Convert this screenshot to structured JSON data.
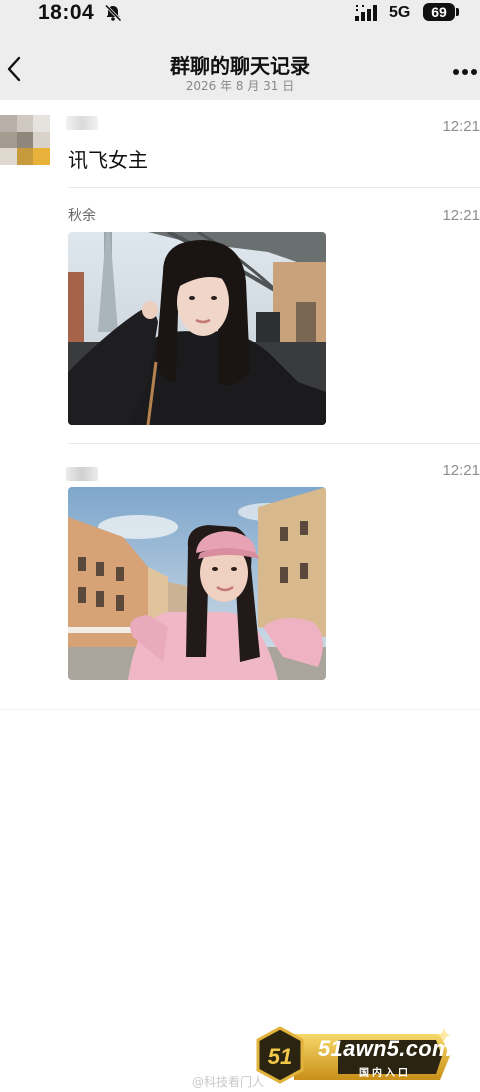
{
  "status_bar": {
    "time": "18:04",
    "network": "5G",
    "battery": "69",
    "icons": [
      "mute-icon",
      "signal-icon"
    ]
  },
  "header": {
    "back_icon": "chevron-left-icon",
    "title": "群聊的聊天记录",
    "subtitle": "2026 年 8 月 31 日",
    "more_icon": "more-dots-icon"
  },
  "messages": [
    {
      "sender": "",
      "time": "12:21",
      "text": "讯飞女主"
    },
    {
      "sender": "秋余",
      "time": "12:21",
      "type": "image",
      "image": "selfie-black-sweater"
    },
    {
      "sender": "",
      "time": "12:21",
      "type": "image",
      "image": "selfie-pink-cap"
    }
  ],
  "watermark": {
    "logo_text": "51",
    "site": "51awn5.com",
    "tag": "国内入口",
    "weibo_handle": "@科技看门人"
  },
  "colors": {
    "header_bg": "#ededed",
    "time_gray": "#8e8e8e",
    "badge_gold": "#d9a627",
    "badge_dark": "#2a2410"
  }
}
